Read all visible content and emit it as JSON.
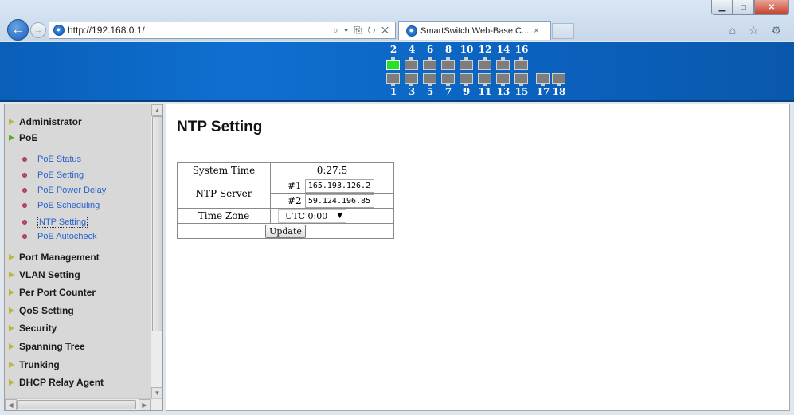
{
  "browser": {
    "url": "http://192.168.0.1/",
    "tab_title": "SmartSwitch Web-Base C...",
    "tab_close": "×",
    "addr_tools": "⌕ ▾ ⎘ ↻ ✕",
    "right_tools": "⌂ ☆ ⚙",
    "window_min": "▁",
    "window_max": "□",
    "window_close": "✕"
  },
  "ports": {
    "top": [
      "2",
      "4",
      "6",
      "8",
      "10",
      "12",
      "14",
      "16"
    ],
    "bottom": [
      "1",
      "3",
      "5",
      "7",
      "9",
      "11",
      "13",
      "15",
      "17",
      "18"
    ],
    "active_port": "2"
  },
  "sidebar": {
    "sections": [
      {
        "label": "Administrator",
        "open": false
      },
      {
        "label": "PoE",
        "open": true
      },
      {
        "label": "Port Management",
        "open": false
      },
      {
        "label": "VLAN Setting",
        "open": false
      },
      {
        "label": "Per Port Counter",
        "open": false
      },
      {
        "label": "QoS Setting",
        "open": false
      },
      {
        "label": "Security",
        "open": false
      },
      {
        "label": "Spanning Tree",
        "open": false
      },
      {
        "label": "Trunking",
        "open": false
      },
      {
        "label": "DHCP Relay Agent",
        "open": false
      }
    ],
    "poe_items": [
      "PoE Status",
      "PoE Setting",
      "PoE Power Delay",
      "PoE Scheduling",
      "NTP Setting",
      "PoE Autocheck"
    ],
    "active_item": "NTP Setting"
  },
  "page": {
    "title": "NTP Setting",
    "system_time_label": "System Time",
    "system_time_value": "0:27:5",
    "ntp_server_label": "NTP Server",
    "server1_index": "#1",
    "server1_value": "165.193.126.2",
    "server2_index": "#2",
    "server2_value": "59.124.196.85",
    "time_zone_label": "Time Zone",
    "time_zone_value": "UTC 0:00",
    "update_label": "Update"
  },
  "colors": {
    "banner": "#0f6fd0",
    "active_port": "#28e028",
    "link": "#2a62c9"
  }
}
